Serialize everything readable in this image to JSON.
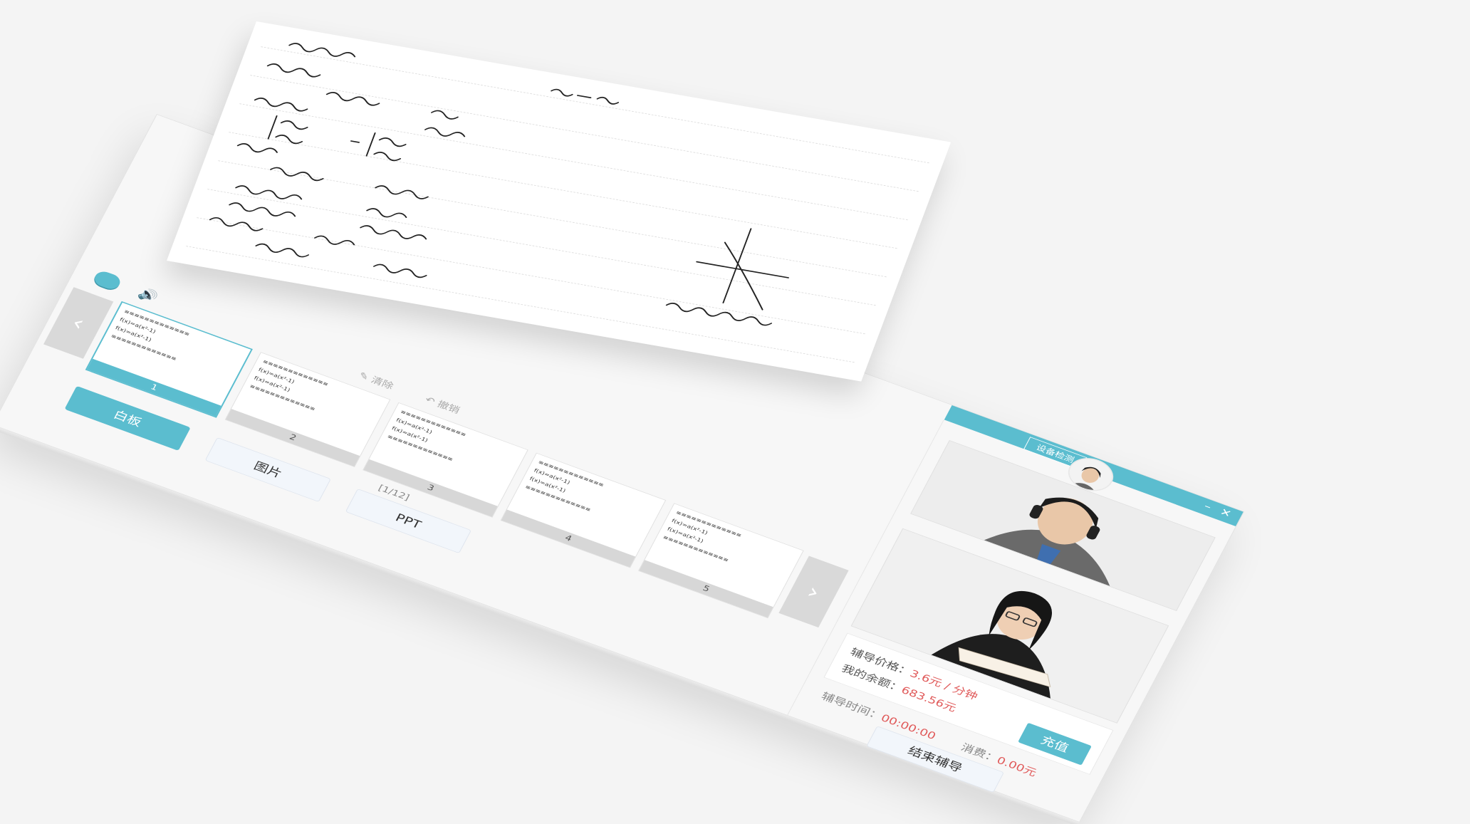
{
  "titlebar": {
    "device_check": "设备检测",
    "minimize": "–",
    "close": "✕"
  },
  "toolbar": {
    "clear": "清除",
    "undo": "撤销"
  },
  "thumbnails": {
    "items": [
      {
        "num": "1",
        "active": true
      },
      {
        "num": "2",
        "active": false
      },
      {
        "num": "3",
        "active": false
      },
      {
        "num": "4",
        "active": false
      },
      {
        "num": "5",
        "active": false
      }
    ],
    "pager": "[1/12]"
  },
  "tabs": {
    "whiteboard": "白板",
    "image": "图片",
    "ppt": "PPT"
  },
  "pricing": {
    "price_label": "辅导价格：",
    "price_value": "3.6元 / 分钟",
    "balance_label": "我的余额：",
    "balance_value": "683.56元",
    "recharge": "充值"
  },
  "session": {
    "time_label": "辅导时间：",
    "time_value": "00:00:00",
    "cost_label": "消费：",
    "cost_value": "0.00元",
    "end_button": "结束辅导"
  },
  "colors": {
    "accent": "#5bbdcf",
    "highlight": "#e05a5a"
  }
}
